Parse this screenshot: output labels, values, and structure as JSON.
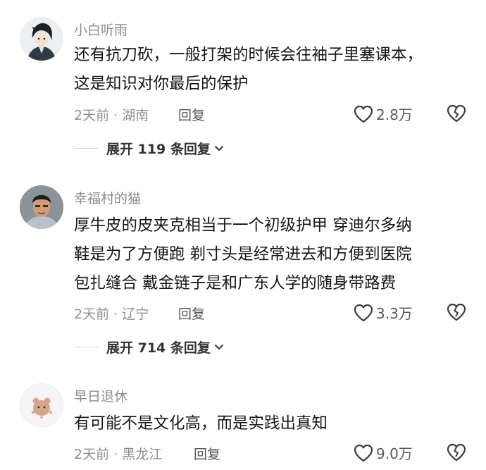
{
  "comments": [
    {
      "username": "小白听雨",
      "lines": [
        "还有抗刀砍，一般打架的时候会往袖子里塞课本，",
        "这是知识对你最后的保护"
      ],
      "time": "2天前",
      "location": "湖南",
      "reply_label": "回复",
      "likes": "2.8万",
      "expand_label": "展开 119 条回复"
    },
    {
      "username": "幸福村的猫",
      "lines": [
        "厚牛皮的皮夹克相当于一个初级护甲 穿迪尔多纳",
        "鞋是为了方便跑 剃寸头是经常进去和方便到医院",
        "包扎缝合 戴金链子是和广东人学的随身带路费"
      ],
      "time": "2天前",
      "location": "辽宁",
      "reply_label": "回复",
      "likes": "3.3万",
      "expand_label": "展开 714 条回复"
    },
    {
      "username": "早日退休",
      "lines": [
        "有可能不是文化高，而是实践出真知"
      ],
      "time": "2天前",
      "location": "黑龙江",
      "reply_label": "回复",
      "likes": "9.0万"
    }
  ],
  "separator": " · ",
  "icons": {
    "like": "heart-outline-icon",
    "dislike": "broken-heart-icon",
    "expand": "chevron-down-icon"
  }
}
